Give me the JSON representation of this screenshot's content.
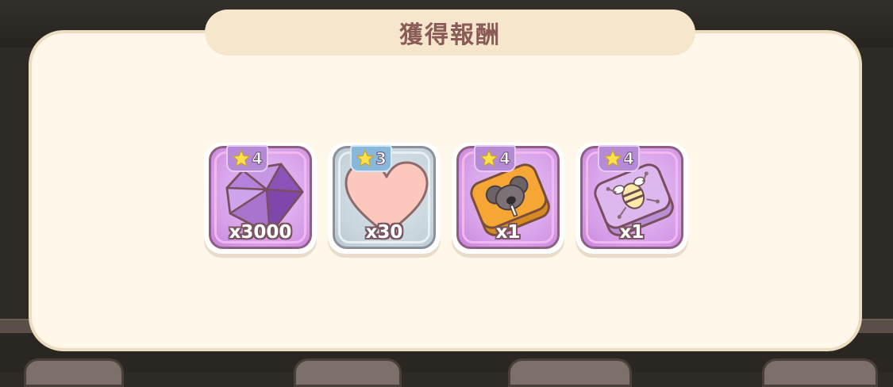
{
  "dialog": {
    "title": "獲得報酬"
  },
  "rewards": [
    {
      "icon": "diamond-icon",
      "rarity": "4",
      "quantity": "x3000"
    },
    {
      "icon": "heart-icon",
      "rarity": "3",
      "quantity": "x30"
    },
    {
      "icon": "koala-badge-icon",
      "rarity": "4",
      "quantity": "x1"
    },
    {
      "icon": "bee-badge-icon",
      "rarity": "4",
      "quantity": "x1"
    }
  ],
  "colors": {
    "panel_bg": "#fef7ea",
    "title_bar": "#f6e6cb",
    "title_text": "#8a5c57",
    "rarity4_card": "#d59de8",
    "rarity3_card": "#c7d4dc",
    "star": "#fde14a"
  }
}
